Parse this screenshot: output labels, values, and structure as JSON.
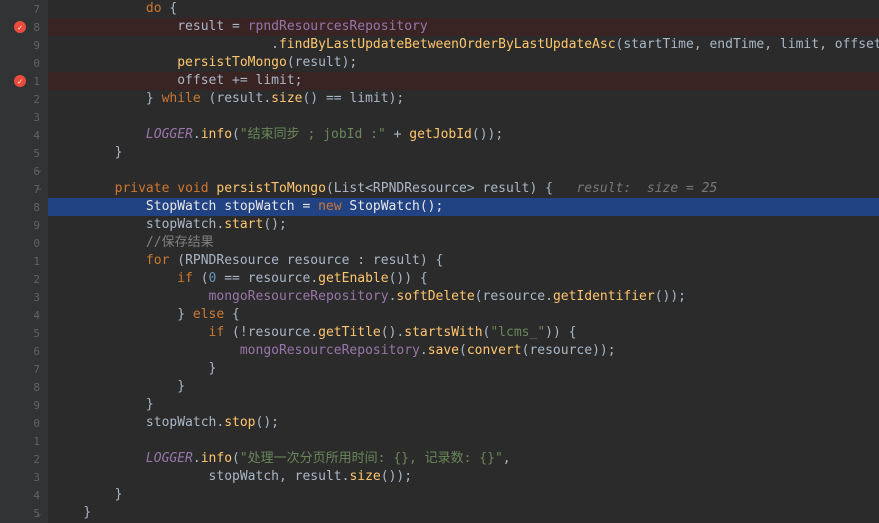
{
  "gutter": {
    "lines": [
      "7",
      "8",
      "9",
      "0",
      "1",
      "2",
      "3",
      "4",
      "5",
      "6",
      "7",
      "8",
      "9",
      "0",
      "1",
      "2",
      "3",
      "4",
      "5",
      "6",
      "7",
      "8",
      "9",
      "0",
      "1",
      "2",
      "3",
      "4",
      "5"
    ],
    "icons": {
      "1": "red",
      "4": "red"
    },
    "folds": {
      "9": "minus",
      "10": "minus",
      "28": "close"
    }
  },
  "hint": {
    "result": "result:",
    "size": "size = 25"
  },
  "code": [
    {
      "indent": 3,
      "bg": "",
      "tokens": [
        [
          "kw",
          "do"
        ],
        [
          "op",
          " {"
        ]
      ]
    },
    {
      "indent": 4,
      "bg": "bp-red",
      "tokens": [
        [
          "ident",
          "result"
        ],
        [
          "op",
          " = "
        ],
        [
          "var",
          "rpndResourcesRepository"
        ]
      ]
    },
    {
      "indent": 6,
      "bg": "",
      "tokens": [
        [
          "op",
          "    ."
        ],
        [
          "fn",
          "findByLastUpdateBetweenOrderByLastUpdateAsc"
        ],
        [
          "op",
          "("
        ],
        [
          "ident",
          "startTime"
        ],
        [
          "op",
          ", "
        ],
        [
          "ident",
          "endTime"
        ],
        [
          "op",
          ", "
        ],
        [
          "ident",
          "limit"
        ],
        [
          "op",
          ", "
        ],
        [
          "ident",
          "offset"
        ],
        [
          "op",
          ");"
        ]
      ]
    },
    {
      "indent": 4,
      "bg": "",
      "tokens": [
        [
          "fn",
          "persistToMongo"
        ],
        [
          "op",
          "("
        ],
        [
          "ident",
          "result"
        ],
        [
          "op",
          ");"
        ]
      ]
    },
    {
      "indent": 4,
      "bg": "bp-red",
      "tokens": [
        [
          "ident",
          "offset"
        ],
        [
          "op",
          " += "
        ],
        [
          "ident",
          "limit"
        ],
        [
          "op",
          ";"
        ]
      ]
    },
    {
      "indent": 3,
      "bg": "",
      "tokens": [
        [
          "op",
          "} "
        ],
        [
          "kw",
          "while"
        ],
        [
          "op",
          " ("
        ],
        [
          "ident",
          "result"
        ],
        [
          "op",
          "."
        ],
        [
          "fn",
          "size"
        ],
        [
          "op",
          "() == "
        ],
        [
          "ident",
          "limit"
        ],
        [
          "op",
          ");"
        ]
      ]
    },
    {
      "indent": 0,
      "bg": "",
      "tokens": []
    },
    {
      "indent": 3,
      "bg": "",
      "tokens": [
        [
          "static-var",
          "LOGGER"
        ],
        [
          "op",
          "."
        ],
        [
          "fn",
          "info"
        ],
        [
          "op",
          "("
        ],
        [
          "str",
          "\"结束同步 ; jobId :\""
        ],
        [
          "op",
          " + "
        ],
        [
          "fn",
          "getJobId"
        ],
        [
          "op",
          "());"
        ]
      ]
    },
    {
      "indent": 2,
      "bg": "",
      "tokens": [
        [
          "op",
          "}"
        ]
      ]
    },
    {
      "indent": 0,
      "bg": "",
      "tokens": []
    },
    {
      "indent": 2,
      "bg": "",
      "tokens": [
        [
          "kw",
          "private void"
        ],
        [
          "op",
          " "
        ],
        [
          "fn",
          "persistToMongo"
        ],
        [
          "op",
          "("
        ],
        [
          "ident",
          "List"
        ],
        [
          "op",
          "<"
        ],
        [
          "ident",
          "RPNDResource"
        ],
        [
          "op",
          "> "
        ],
        [
          "ident",
          "result"
        ],
        [
          "op",
          ") {   "
        ],
        [
          "param-hint",
          "__HINT__"
        ]
      ]
    },
    {
      "indent": 3,
      "bg": "bp-blue",
      "tokens": [
        [
          "plain-bright",
          "StopWatch stopWatch = "
        ],
        [
          "kw",
          "new"
        ],
        [
          "plain-bright",
          " StopWatch();"
        ]
      ]
    },
    {
      "indent": 3,
      "bg": "",
      "tokens": [
        [
          "ident",
          "stopWatch"
        ],
        [
          "op",
          "."
        ],
        [
          "fn",
          "start"
        ],
        [
          "op",
          "();"
        ]
      ]
    },
    {
      "indent": 3,
      "bg": "",
      "tokens": [
        [
          "comment",
          "//保存结果"
        ]
      ]
    },
    {
      "indent": 3,
      "bg": "",
      "tokens": [
        [
          "kw",
          "for"
        ],
        [
          "op",
          " ("
        ],
        [
          "ident",
          "RPNDResource resource"
        ],
        [
          "op",
          " : "
        ],
        [
          "ident",
          "result"
        ],
        [
          "op",
          ") {"
        ]
      ]
    },
    {
      "indent": 4,
      "bg": "",
      "tokens": [
        [
          "kw",
          "if"
        ],
        [
          "op",
          " ("
        ],
        [
          "num",
          "0"
        ],
        [
          "op",
          " == "
        ],
        [
          "ident",
          "resource"
        ],
        [
          "op",
          "."
        ],
        [
          "fn",
          "getEnable"
        ],
        [
          "op",
          "()) {"
        ]
      ]
    },
    {
      "indent": 5,
      "bg": "",
      "tokens": [
        [
          "var",
          "mongoResourceRepository"
        ],
        [
          "op",
          "."
        ],
        [
          "fn",
          "softDelete"
        ],
        [
          "op",
          "("
        ],
        [
          "ident",
          "resource"
        ],
        [
          "op",
          "."
        ],
        [
          "fn",
          "getIdentifier"
        ],
        [
          "op",
          "());"
        ]
      ]
    },
    {
      "indent": 4,
      "bg": "",
      "tokens": [
        [
          "op",
          "} "
        ],
        [
          "kw",
          "else"
        ],
        [
          "op",
          " {"
        ]
      ]
    },
    {
      "indent": 5,
      "bg": "",
      "tokens": [
        [
          "kw",
          "if"
        ],
        [
          "op",
          " (!"
        ],
        [
          "ident",
          "resource"
        ],
        [
          "op",
          "."
        ],
        [
          "fn",
          "getTitle"
        ],
        [
          "op",
          "()."
        ],
        [
          "fn",
          "startsWith"
        ],
        [
          "op",
          "("
        ],
        [
          "str",
          "\"lcms_\""
        ],
        [
          "op",
          ")) {"
        ]
      ]
    },
    {
      "indent": 6,
      "bg": "",
      "tokens": [
        [
          "var",
          "mongoResourceRepository"
        ],
        [
          "op",
          "."
        ],
        [
          "fn",
          "save"
        ],
        [
          "op",
          "("
        ],
        [
          "fn",
          "convert"
        ],
        [
          "op",
          "("
        ],
        [
          "ident",
          "resource"
        ],
        [
          "op",
          "));"
        ]
      ]
    },
    {
      "indent": 5,
      "bg": "",
      "tokens": [
        [
          "op",
          "}"
        ]
      ]
    },
    {
      "indent": 4,
      "bg": "",
      "tokens": [
        [
          "op",
          "}"
        ]
      ]
    },
    {
      "indent": 3,
      "bg": "",
      "tokens": [
        [
          "op",
          "}"
        ]
      ]
    },
    {
      "indent": 3,
      "bg": "",
      "tokens": [
        [
          "ident",
          "stopWatch"
        ],
        [
          "op",
          "."
        ],
        [
          "fn",
          "stop"
        ],
        [
          "op",
          "();"
        ]
      ]
    },
    {
      "indent": 0,
      "bg": "",
      "tokens": []
    },
    {
      "indent": 3,
      "bg": "",
      "tokens": [
        [
          "static-var",
          "LOGGER"
        ],
        [
          "op",
          "."
        ],
        [
          "fn",
          "info"
        ],
        [
          "op",
          "("
        ],
        [
          "str",
          "\"处理一次分页所用时间: {}, 记录数: {}\""
        ],
        [
          "op",
          ","
        ]
      ]
    },
    {
      "indent": 5,
      "bg": "",
      "tokens": [
        [
          "ident",
          "stopWatch"
        ],
        [
          "op",
          ", "
        ],
        [
          "ident",
          "result"
        ],
        [
          "op",
          "."
        ],
        [
          "fn",
          "size"
        ],
        [
          "op",
          "());"
        ]
      ]
    },
    {
      "indent": 2,
      "bg": "",
      "tokens": [
        [
          "op",
          "}"
        ]
      ]
    },
    {
      "indent": 1,
      "bg": "",
      "tokens": [
        [
          "op",
          "}"
        ]
      ]
    }
  ]
}
